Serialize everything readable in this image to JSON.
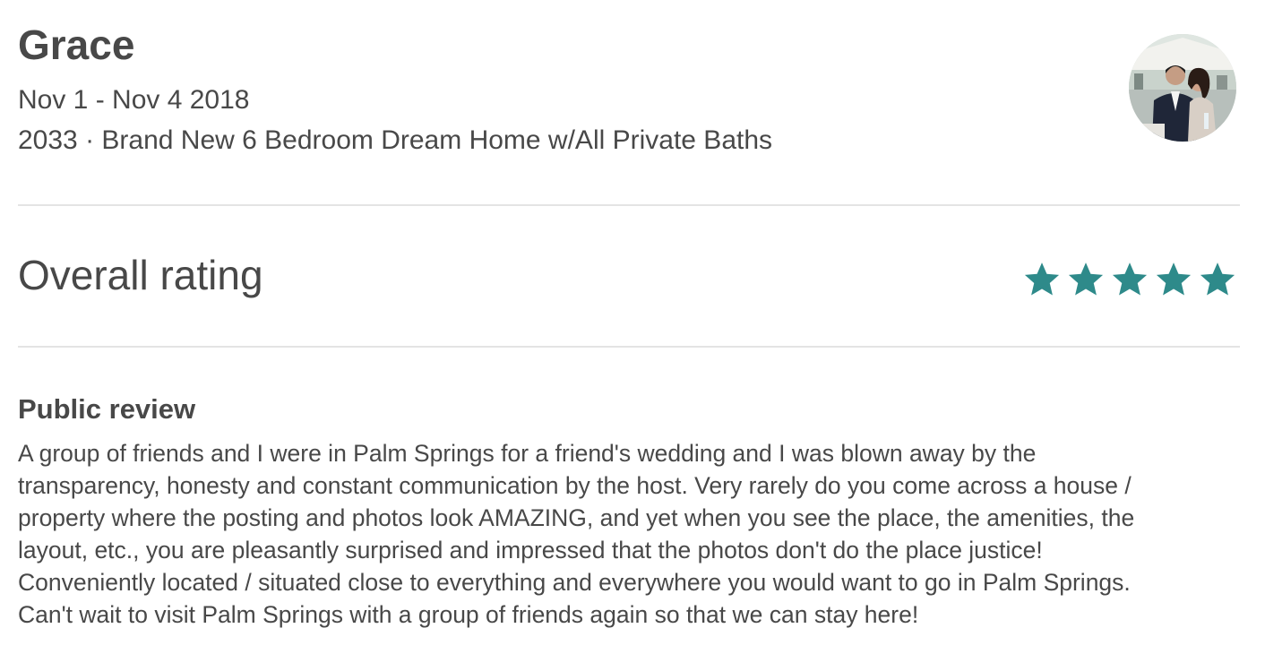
{
  "review": {
    "guest_name": "Grace",
    "stay_dates": "Nov 1 - Nov 4 2018",
    "listing": "2033 · Brand New 6 Bedroom Dream Home w/All Private Baths",
    "avatar_icon": "guest-photo-avatar"
  },
  "overall": {
    "label": "Overall rating",
    "rating": 5,
    "max_rating": 5,
    "star_color": "#2e8a8a",
    "star_icon": "star-icon"
  },
  "public_review": {
    "heading": "Public review",
    "lines": [
      "A group of friends and I were in Palm Springs for a friend's wedding and I was blown away by the",
      "transparency, honesty and constant communication by the host. Very rarely do you come across a house /",
      "property where the posting and photos look AMAZING, and yet when you see the place, the amenities, the",
      "layout, etc., you are pleasantly surprised and impressed that the photos don't do the place justice!",
      "Conveniently located / situated close to everything and everywhere you would want to go in Palm Springs.",
      "Can't wait to visit Palm Springs with a group of friends again so that we can stay here!"
    ]
  }
}
